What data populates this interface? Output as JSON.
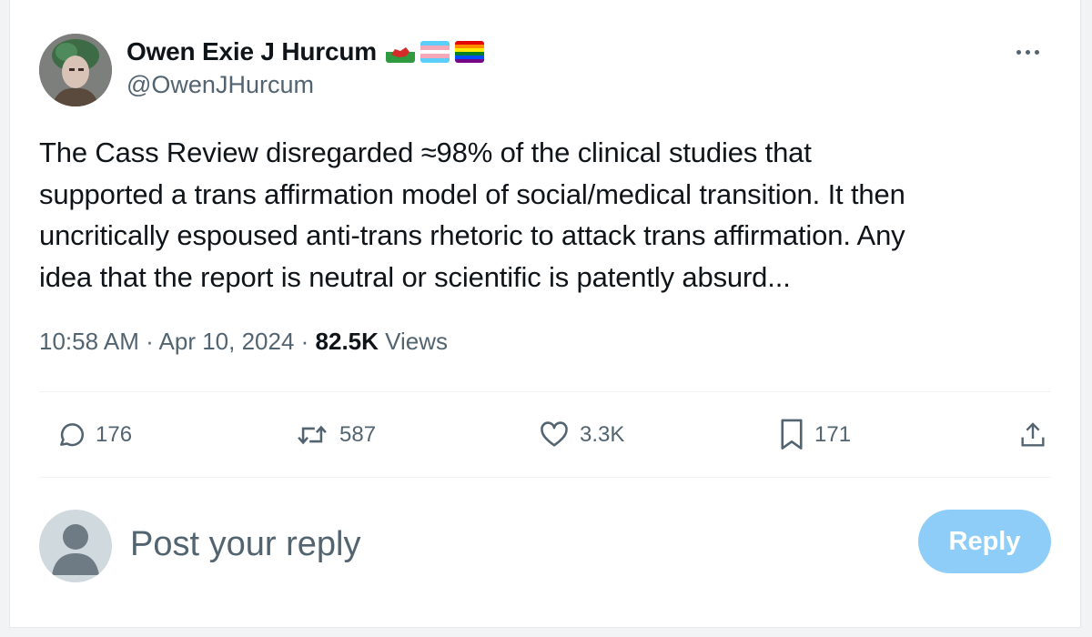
{
  "author": {
    "name": "Owen Exie J Hurcum",
    "handle": "@OwenJHurcum",
    "flags": [
      "wales-flag-icon",
      "transgender-flag-icon",
      "rainbow-flag-icon"
    ]
  },
  "tweet": {
    "text": "The Cass Review disregarded ≈98% of the clinical studies that\nsupported a trans affirmation model of social/medical transition. It then\nuncritically espoused anti-trans rhetoric to attack trans affirmation. Any\nidea that the report is neutral or scientific is patently absurd..."
  },
  "meta": {
    "time": "10:58 AM",
    "sep1": " · ",
    "date": "Apr 10, 2024",
    "sep2": " · ",
    "views_count": "82.5K",
    "views_label": " Views"
  },
  "actions": {
    "replies": "176",
    "reposts": "587",
    "likes": "3.3K",
    "bookmarks": "171"
  },
  "reply_box": {
    "placeholder": "Post your reply",
    "button_label": "Reply"
  },
  "colors": {
    "text": "#0f1419",
    "muted": "#536471",
    "reply_button": "#8ecdf7",
    "divider": "#eff3f4"
  }
}
